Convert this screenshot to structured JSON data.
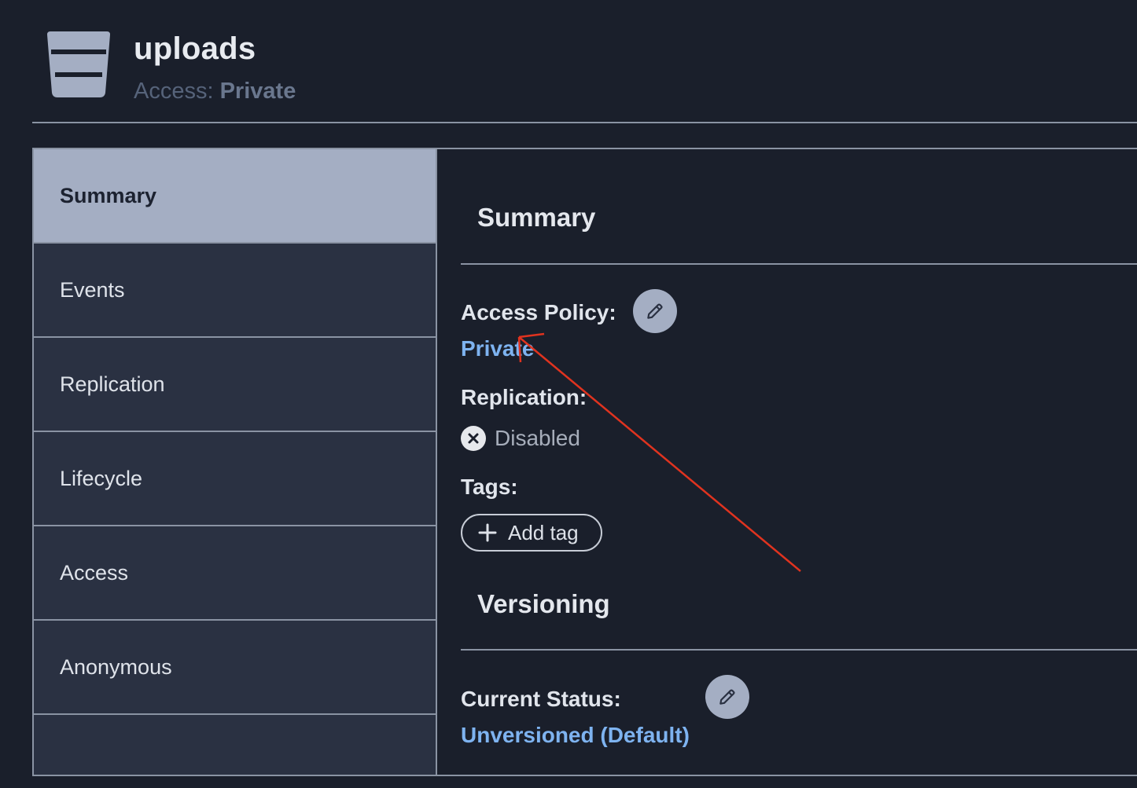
{
  "bucket": {
    "name": "uploads",
    "access_label": "Access: ",
    "access_value": "Private",
    "icon": "bucket-icon"
  },
  "sidebar": {
    "items": [
      {
        "label": "Summary",
        "active": true
      },
      {
        "label": "Events",
        "active": false
      },
      {
        "label": "Replication",
        "active": false
      },
      {
        "label": "Lifecycle",
        "active": false
      },
      {
        "label": "Access",
        "active": false
      },
      {
        "label": "Anonymous",
        "active": false
      }
    ]
  },
  "summary": {
    "title": "Summary",
    "access_policy_label": "Access Policy:",
    "access_policy_value": "Private",
    "replication_label": "Replication:",
    "replication_value": "Disabled",
    "tags_label": "Tags:",
    "add_tag_label": "Add tag"
  },
  "versioning": {
    "title": "Versioning",
    "current_status_label": "Current Status:",
    "current_status_value": "Unversioned (Default)"
  },
  "colors": {
    "background": "#1a1f2b",
    "sidebar_bg": "#2a3142",
    "active_tab": "#a4aec3",
    "link": "#7eb3f0",
    "annotation_arrow": "#e0331f"
  }
}
